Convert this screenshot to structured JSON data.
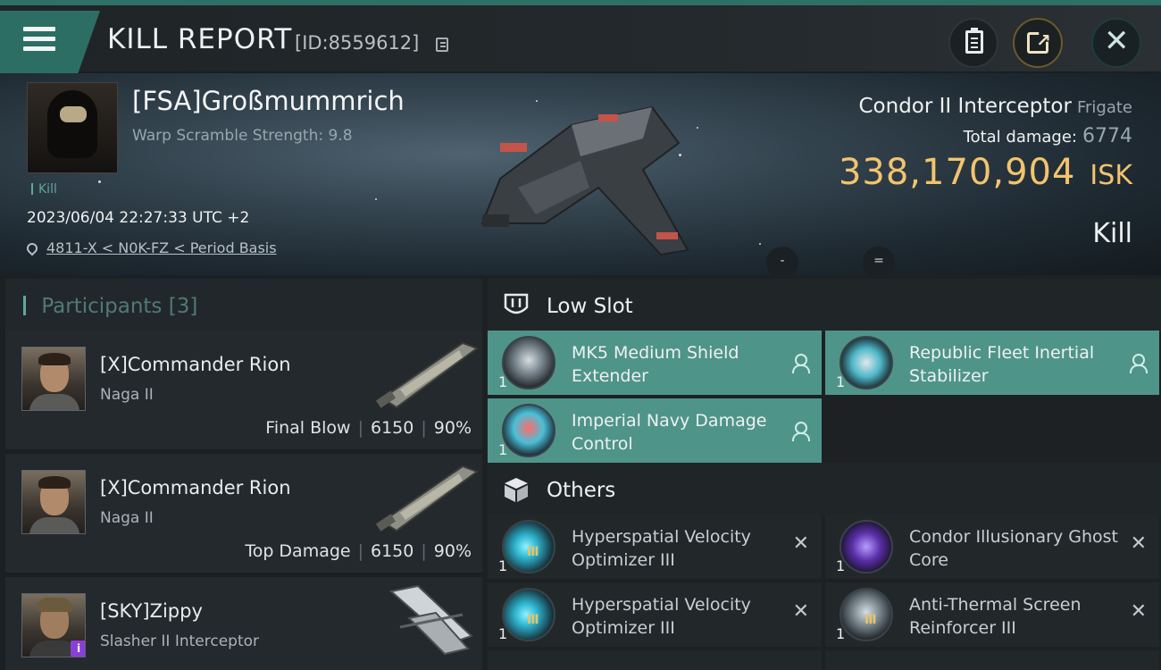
{
  "header": {
    "title": "KILL REPORT",
    "report_id": "[ID:8559612]"
  },
  "victim": {
    "name": "[FSA]Großmummrich",
    "warp_scramble": "Warp Scramble Strength: 9.8",
    "tag": "Kill",
    "datetime": "2023/06/04 22:27:33 UTC +2",
    "location": "4811-X < N0K-FZ < Period Basis",
    "ship_name": "Condor II Interceptor",
    "ship_category": "Frigate",
    "total_damage_label": "Total damage:",
    "total_damage_value": "6774",
    "isk_value": "338,170,904",
    "isk_unit": "ISK",
    "result": "Kill",
    "dot_btn_left": "-",
    "dot_btn_right": "="
  },
  "participants": {
    "label": "Participants",
    "count": "[3]",
    "items": [
      {
        "name": "[X]Commander Rion",
        "ship": "Naga II",
        "role": "Final Blow",
        "damage": "6150",
        "percent": "90%"
      },
      {
        "name": "[X]Commander Rion",
        "ship": "Naga II",
        "role": "Top Damage",
        "damage": "6150",
        "percent": "90%"
      },
      {
        "name": "[SKY]Zippy",
        "ship": "Slasher II Interceptor",
        "badge": "i"
      }
    ]
  },
  "sections": {
    "low_slot": {
      "label": "Low Slot",
      "modules": [
        {
          "qty": "1",
          "name": "MK5 Medium Shield Extender",
          "icon": "shield-extender-icon"
        },
        {
          "qty": "1",
          "name": "Republic Fleet Inertial Stabilizer",
          "icon": "inertial-stabilizer-icon"
        },
        {
          "qty": "1",
          "name": "Imperial Navy Damage Control",
          "icon": "damage-control-icon"
        }
      ]
    },
    "others": {
      "label": "Others",
      "modules": [
        {
          "qty": "1",
          "name": "Hyperspatial Velocity Optimizer III",
          "tier": "III",
          "icon": "velocity-optimizer-icon"
        },
        {
          "qty": "1",
          "name": "Condor Illusionary Ghost Core",
          "icon": "ghost-core-icon"
        },
        {
          "qty": "1",
          "name": "Hyperspatial Velocity Optimizer III",
          "tier": "III",
          "icon": "velocity-optimizer-icon"
        },
        {
          "qty": "1",
          "name": "Anti-Thermal Screen Reinforcer III",
          "tier": "III",
          "icon": "thermal-reinforcer-icon"
        }
      ]
    }
  },
  "colors": {
    "accent_teal": "#2c6e64",
    "low_slot_bg": "#4f9489",
    "isk_gold": "#f2c46e",
    "badge_purple": "#8a3fd8"
  }
}
